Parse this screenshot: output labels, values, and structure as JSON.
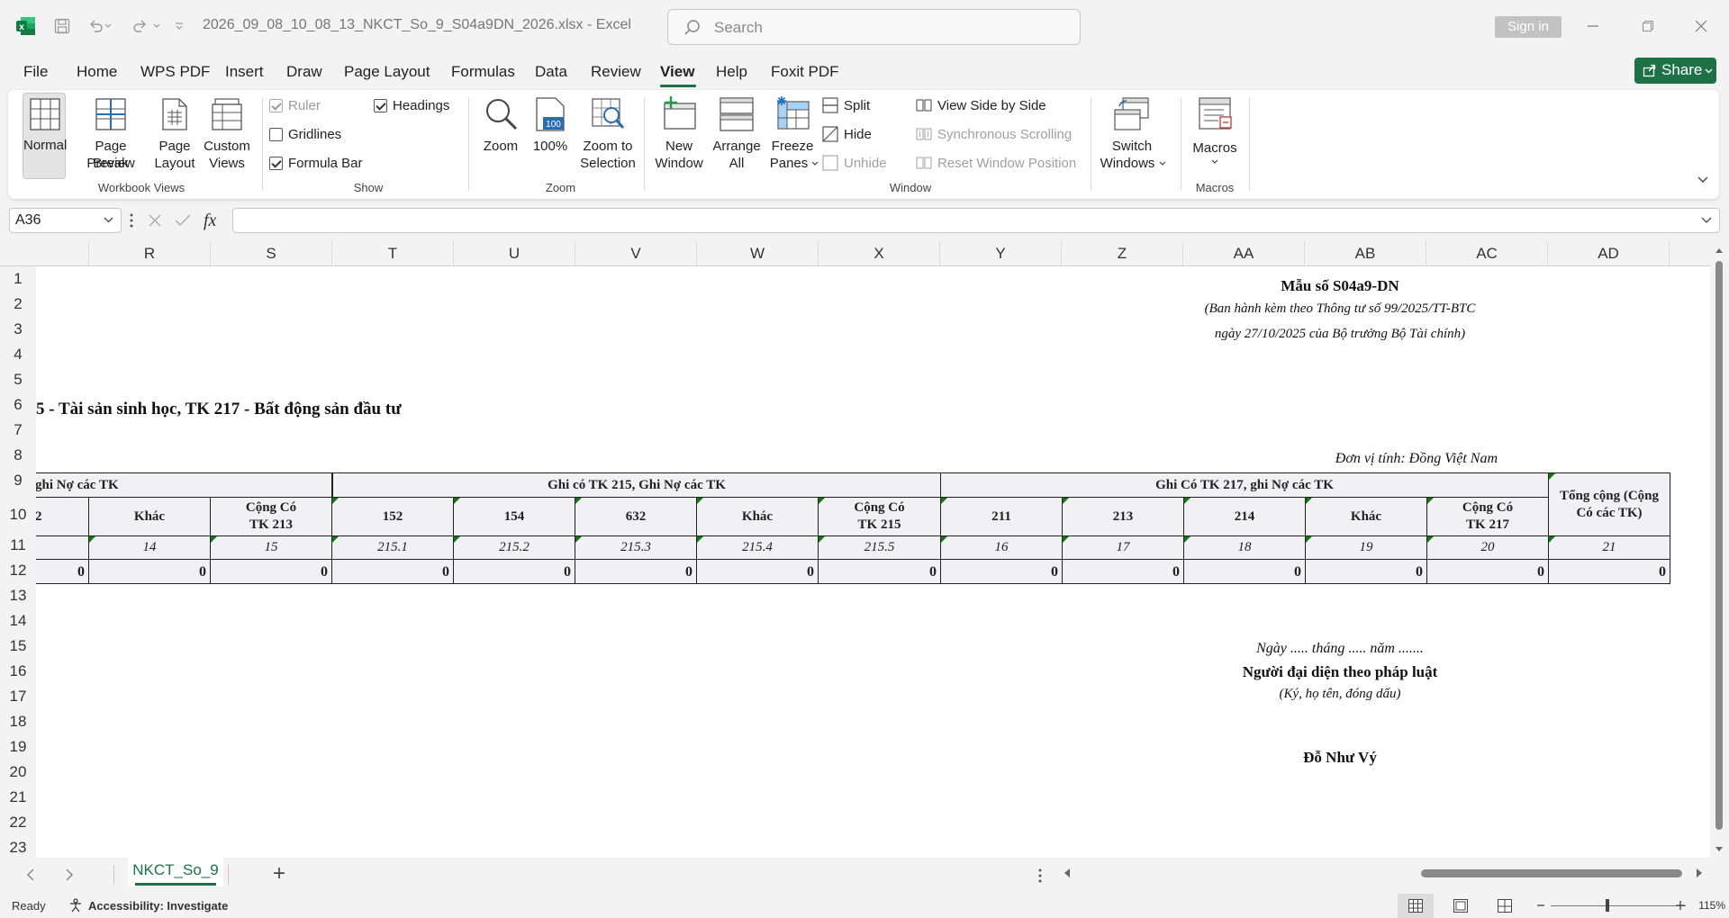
{
  "titlebar": {
    "doc_title": "2026_09_08_10_08_13_NKCT_So_9_S04a9DN_2026.xlsx  -  Excel",
    "search_placeholder": "Search",
    "sign_in": "Sign in"
  },
  "menu": [
    "File",
    "Home",
    "WPS PDF",
    "Insert",
    "Draw",
    "Page Layout",
    "Formulas",
    "Data",
    "Review",
    "View",
    "Help",
    "Foxit PDF"
  ],
  "share_label": "Share",
  "ribbon": {
    "workbook_views": {
      "label": "Workbook Views",
      "normal": "Normal",
      "page_break_1": "Page Break",
      "page_break_2": "Preview",
      "page_layout_1": "Page",
      "page_layout_2": "Layout",
      "custom_1": "Custom",
      "custom_2": "Views"
    },
    "show": {
      "label": "Show",
      "ruler": "Ruler",
      "gridlines": "Gridlines",
      "formula_bar": "Formula Bar",
      "headings": "Headings"
    },
    "zoom": {
      "label": "Zoom",
      "zoom": "Zoom",
      "hundred": "100%",
      "zoom_sel_1": "Zoom to",
      "zoom_sel_2": "Selection",
      "icon_100": "100"
    },
    "window": {
      "label": "Window",
      "new_1": "New",
      "new_2": "Window",
      "arrange_1": "Arrange",
      "arrange_2": "All",
      "freeze_1": "Freeze",
      "freeze_2": "Panes",
      "split": "Split",
      "hide": "Hide",
      "unhide": "Unhide",
      "side_by_side": "View Side by Side",
      "sync_scroll": "Synchronous Scrolling",
      "reset_pos": "Reset Window Position",
      "switch_1": "Switch",
      "switch_2": "Windows"
    },
    "macros": {
      "label": "Macros",
      "macros": "Macros"
    }
  },
  "formula_bar": {
    "name_box": "A36",
    "fx": "fx",
    "formula": ""
  },
  "columns": [
    "R",
    "S",
    "T",
    "U",
    "V",
    "W",
    "X",
    "Y",
    "Z",
    "AA",
    "AB",
    "AC",
    "AD"
  ],
  "rows": [
    "1",
    "2",
    "3",
    "4",
    "5",
    "6",
    "7",
    "8",
    "9",
    "10",
    "11",
    "12",
    "13",
    "14",
    "15",
    "16",
    "17",
    "18",
    "19",
    "20",
    "21",
    "22",
    "23"
  ],
  "sheet": {
    "form_code": "Mẫu số S04a9-DN",
    "circular_1": "(Ban hành kèm theo Thông tư số 99/2025/TT-BTC",
    "circular_2": "ngày 27/10/2025 của Bộ trưởng Bộ Tài chính)",
    "title": "5 - Tài sản sinh học, TK 217 - Bất động sản đầu tư",
    "unit": "Đơn vị tính: Đồng Việt Nam",
    "group_left": "ghi Nợ các TK",
    "group_215": "Ghi có TK 215, Ghi Nợ các TK",
    "group_217": "Ghi Có TK 217, ghi Nợ các TK",
    "total_header": "Tổng cộng (Cộng Có các TK)",
    "sub_headers": [
      "2",
      "Khác",
      "Cộng Có TK 213",
      "152",
      "154",
      "632",
      "Khác",
      "Cộng Có TK 215",
      "211",
      "213",
      "214",
      "Khác",
      "Cộng Có TK 217"
    ],
    "codes": [
      "",
      "14",
      "15",
      "215.1",
      "215.2",
      "215.3",
      "215.4",
      "215.5",
      "16",
      "17",
      "18",
      "19",
      "20",
      "21"
    ],
    "totals": [
      "0",
      "0",
      "0",
      "0",
      "0",
      "0",
      "0",
      "0",
      "0",
      "0",
      "0",
      "0",
      "0",
      "0"
    ],
    "date_line": "Ngày ..... tháng ..... năm .......",
    "signer_title": "Người đại diện theo pháp luật",
    "signer_note": "(Ký, họ tên, đóng dấu)",
    "signer_name": "Đỗ Như Vý"
  },
  "tabs": {
    "sheet_name": "NKCT_So_9",
    "add": "+"
  },
  "status": {
    "ready": "Ready",
    "accessibility": "Accessibility: Investigate",
    "zoom": "115%"
  },
  "colors": {
    "accent": "#1e7145",
    "header_fill": "#f1f1f5",
    "triangle": "#0a7a0a"
  }
}
